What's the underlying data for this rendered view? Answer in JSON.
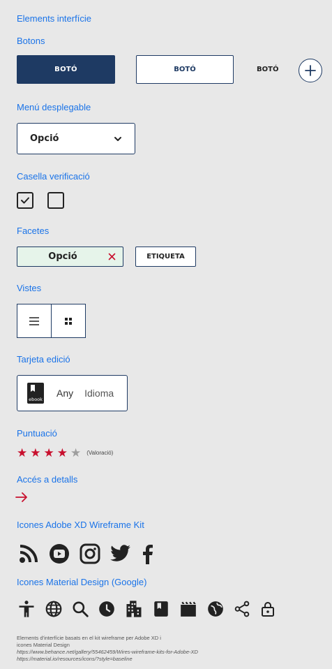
{
  "headings": {
    "elements": "Elements interfície",
    "buttons": "Botons",
    "dropdown": "Menú desplegable",
    "checkbox": "Casella verificació",
    "facets": "Facetes",
    "views": "Vistes",
    "card": "Tarjeta edició",
    "rating": "Puntuació",
    "details": "Accés a detalls",
    "adobe_icons": "Icones Adobe XD Wireframe Kit",
    "material_icons": "Icones Material Design (Google)"
  },
  "buttons": {
    "primary": "BOTÓ",
    "secondary": "BOTÓ",
    "text": "BOTÓ",
    "add_icon": "plus-circle"
  },
  "dropdown": {
    "value": "Opció",
    "icon": "chevron-down"
  },
  "checkboxes": [
    {
      "checked": true
    },
    {
      "checked": false
    }
  ],
  "facets": {
    "option": "Opció",
    "remove_icon": "close",
    "tag": "ETIQUETA"
  },
  "views": {
    "items": [
      "list-view",
      "grid-view"
    ]
  },
  "card": {
    "badge": "ebook",
    "year": "Any",
    "language": "Idioma"
  },
  "rating": {
    "value": 4,
    "max": 5,
    "label": "(Valoració)",
    "filled_color": "#c8102e",
    "empty_color": "#9e9e9e"
  },
  "details": {
    "icon": "arrow-right",
    "color": "#c8102e"
  },
  "adobe_icons": [
    "rss",
    "youtube",
    "instagram",
    "twitter",
    "facebook"
  ],
  "material_icons": [
    "accessibility",
    "language",
    "search",
    "schedule",
    "business",
    "book",
    "movie",
    "public",
    "share",
    "lock"
  ],
  "footer": {
    "line1": "Elements d'interfície basats en el kit wireframe per Adobe XD i",
    "line2": "icones Material Design",
    "line3": "https://www.behance.net/gallery/55462459/Wires-wireframe-kits-for-Adobe-XD",
    "line4": "https://material.io/resources/icons/?style=baseline"
  },
  "colors": {
    "primary": "#1e3a63",
    "heading": "#1a73e8",
    "accent": "#c8102e",
    "background": "#e8e8e8"
  }
}
